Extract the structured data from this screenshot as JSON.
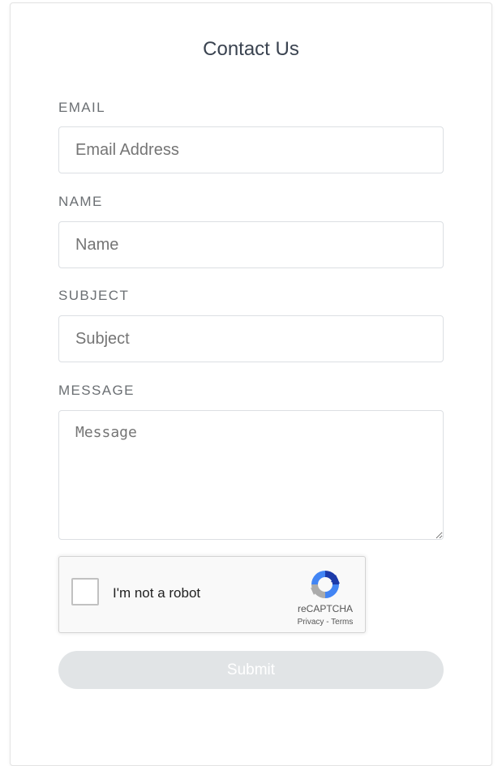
{
  "form": {
    "title": "Contact Us",
    "fields": {
      "email": {
        "label": "EMAIL",
        "placeholder": "Email Address",
        "value": ""
      },
      "name": {
        "label": "NAME",
        "placeholder": "Name",
        "value": ""
      },
      "subject": {
        "label": "SUBJECT",
        "placeholder": "Subject",
        "value": ""
      },
      "message": {
        "label": "MESSAGE",
        "placeholder": "Message",
        "value": ""
      }
    },
    "recaptcha": {
      "checkbox_label": "I'm not a robot",
      "brand": "reCAPTCHA",
      "privacy_link": "Privacy",
      "separator": " - ",
      "terms_link": "Terms",
      "checked": false,
      "icon": "recaptcha-logo-icon"
    },
    "submit_label": "Submit",
    "submit_enabled": false
  },
  "colors": {
    "title": "#3a4350",
    "label": "#6b6f73",
    "border": "#dcdfe3",
    "submit_bg": "#e1e4e6"
  }
}
